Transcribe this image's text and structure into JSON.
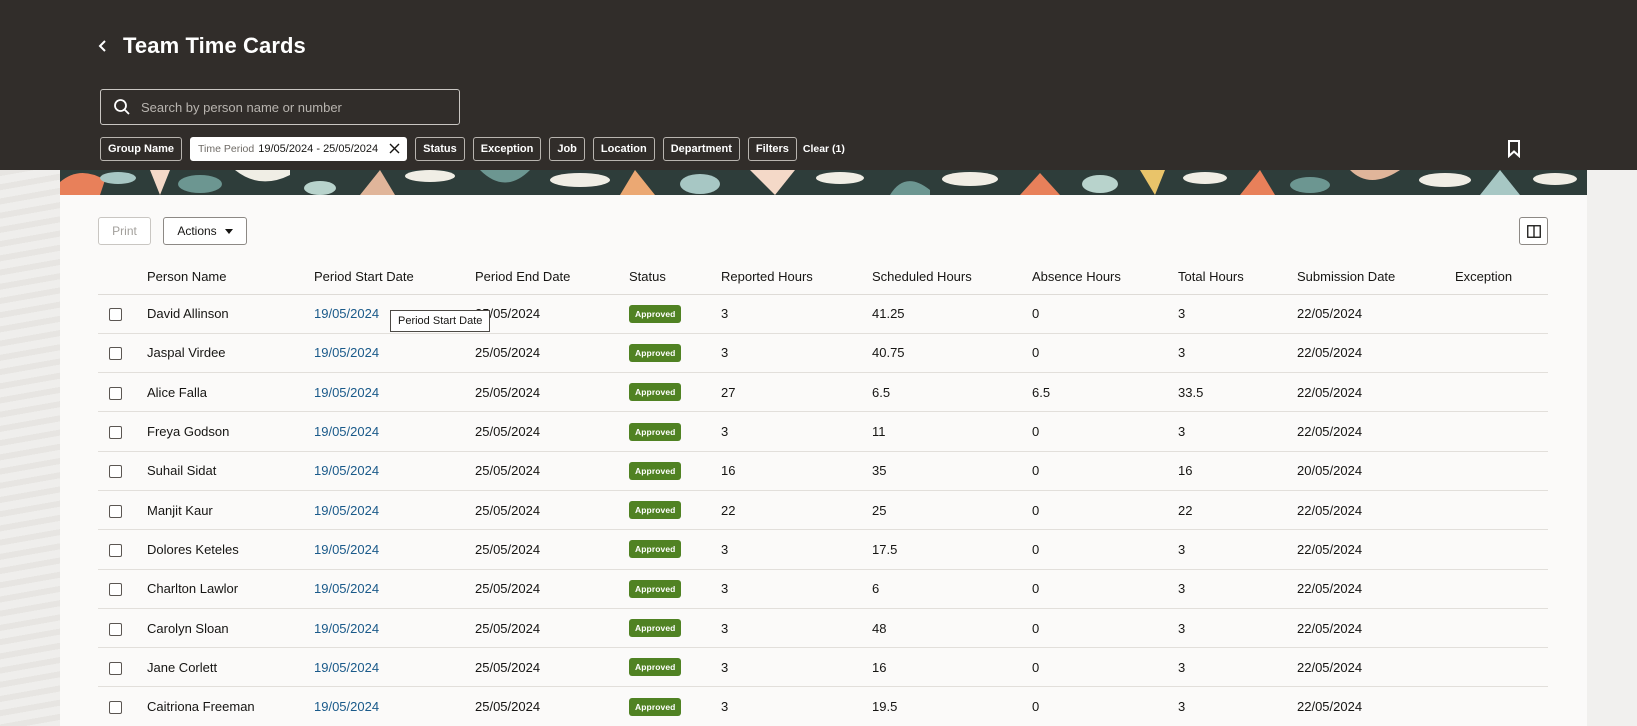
{
  "header": {
    "title": "Team Time Cards",
    "search_placeholder": "Search by person name or number",
    "filters": {
      "group_name": "Group Name",
      "time_period_key": "Time Period",
      "time_period_value": "19/05/2024 - 25/05/2024",
      "status": "Status",
      "exception": "Exception",
      "job": "Job",
      "location": "Location",
      "department": "Department",
      "filters": "Filters",
      "clear": "Clear (1)"
    }
  },
  "toolbar": {
    "print_label": "Print",
    "actions_label": "Actions"
  },
  "tooltip": "Period Start Date",
  "table": {
    "columns": [
      "Person Name",
      "Period Start Date",
      "Period End Date",
      "Status",
      "Reported Hours",
      "Scheduled Hours",
      "Absence Hours",
      "Total Hours",
      "Submission Date",
      "Exception"
    ],
    "rows": [
      {
        "name": "David Allinson",
        "start": "19/05/2024",
        "end": "25/05/2024",
        "status": "Approved",
        "reported": "3",
        "scheduled": "41.25",
        "absence": "0",
        "total": "3",
        "submitted": "22/05/2024",
        "exception": ""
      },
      {
        "name": "Jaspal Virdee",
        "start": "19/05/2024",
        "end": "25/05/2024",
        "status": "Approved",
        "reported": "3",
        "scheduled": "40.75",
        "absence": "0",
        "total": "3",
        "submitted": "22/05/2024",
        "exception": ""
      },
      {
        "name": "Alice Falla",
        "start": "19/05/2024",
        "end": "25/05/2024",
        "status": "Approved",
        "reported": "27",
        "scheduled": "6.5",
        "absence": "6.5",
        "total": "33.5",
        "submitted": "22/05/2024",
        "exception": ""
      },
      {
        "name": "Freya Godson",
        "start": "19/05/2024",
        "end": "25/05/2024",
        "status": "Approved",
        "reported": "3",
        "scheduled": "11",
        "absence": "0",
        "total": "3",
        "submitted": "22/05/2024",
        "exception": ""
      },
      {
        "name": "Suhail Sidat",
        "start": "19/05/2024",
        "end": "25/05/2024",
        "status": "Approved",
        "reported": "16",
        "scheduled": "35",
        "absence": "0",
        "total": "16",
        "submitted": "20/05/2024",
        "exception": ""
      },
      {
        "name": "Manjit Kaur",
        "start": "19/05/2024",
        "end": "25/05/2024",
        "status": "Approved",
        "reported": "22",
        "scheduled": "25",
        "absence": "0",
        "total": "22",
        "submitted": "22/05/2024",
        "exception": ""
      },
      {
        "name": "Dolores Keteles",
        "start": "19/05/2024",
        "end": "25/05/2024",
        "status": "Approved",
        "reported": "3",
        "scheduled": "17.5",
        "absence": "0",
        "total": "3",
        "submitted": "22/05/2024",
        "exception": ""
      },
      {
        "name": "Charlton Lawlor",
        "start": "19/05/2024",
        "end": "25/05/2024",
        "status": "Approved",
        "reported": "3",
        "scheduled": "6",
        "absence": "0",
        "total": "3",
        "submitted": "22/05/2024",
        "exception": ""
      },
      {
        "name": "Carolyn Sloan",
        "start": "19/05/2024",
        "end": "25/05/2024",
        "status": "Approved",
        "reported": "3",
        "scheduled": "48",
        "absence": "0",
        "total": "3",
        "submitted": "22/05/2024",
        "exception": ""
      },
      {
        "name": "Jane Corlett",
        "start": "19/05/2024",
        "end": "25/05/2024",
        "status": "Approved",
        "reported": "3",
        "scheduled": "16",
        "absence": "0",
        "total": "3",
        "submitted": "22/05/2024",
        "exception": ""
      },
      {
        "name": "Caitriona Freeman",
        "start": "19/05/2024",
        "end": "25/05/2024",
        "status": "Approved",
        "reported": "3",
        "scheduled": "19.5",
        "absence": "0",
        "total": "3",
        "submitted": "22/05/2024",
        "exception": ""
      }
    ]
  },
  "colors": {
    "header_bg": "#312d2a",
    "approved_badge": "#508223",
    "link": "#1a5a8a"
  }
}
